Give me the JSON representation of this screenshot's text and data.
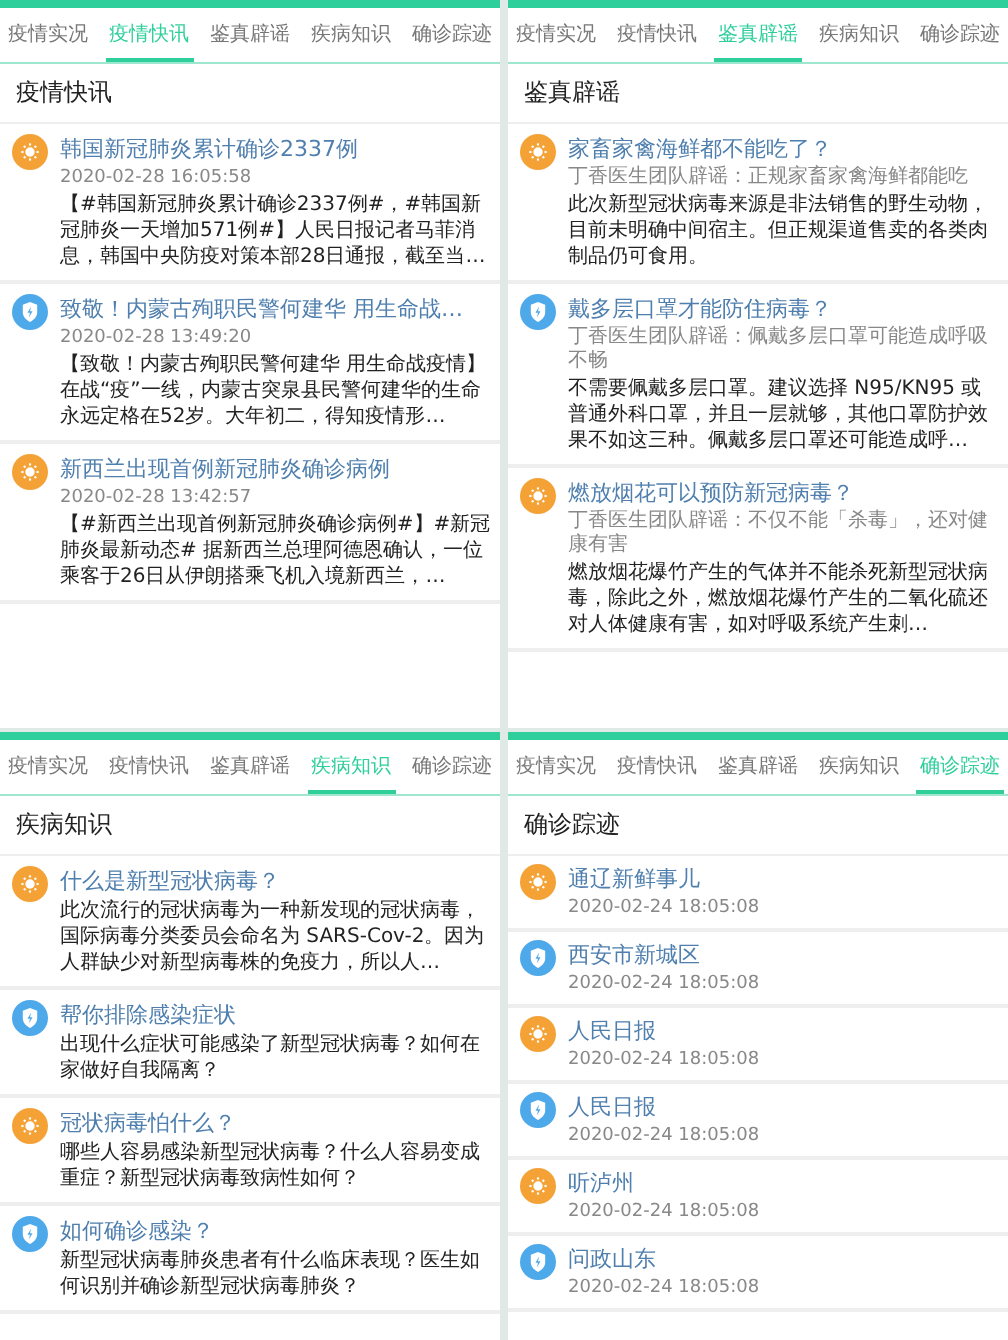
{
  "panels": [
    {
      "tabs": [
        {
          "label": "疫情实况",
          "selected": false
        },
        {
          "label": "疫情快讯",
          "selected": true
        },
        {
          "label": "鉴真辟谣",
          "selected": false
        },
        {
          "label": "疾病知识",
          "selected": false
        },
        {
          "label": "确诊踪迹",
          "selected": false
        }
      ],
      "heading": "疫情快讯",
      "items": [
        {
          "kind": "sun",
          "title": "韩国新冠肺炎累计确诊2337例",
          "meta": "2020-02-28 16:05:58",
          "body": "【#韩国新冠肺炎累计确诊2337例#，#韩国新冠肺炎一天增加571例#】人民日报记者马菲消息，韩国中央防疫对策本部28日通报，截至当…"
        },
        {
          "kind": "shield",
          "title": "致敬！内蒙古殉职民警何建华 用生命战…",
          "meta": "2020-02-28 13:49:20",
          "body": "【致敬！内蒙古殉职民警何建华 用生命战疫情】在战“疫”一线，内蒙古突泉县民警何建华的生命永远定格在52岁。大年初二，得知疫情形…"
        },
        {
          "kind": "sun",
          "title": "新西兰出现首例新冠肺炎确诊病例",
          "meta": "2020-02-28 13:42:57",
          "body": "【#新西兰出现首例新冠肺炎确诊病例#】#新冠肺炎最新动态# 据新西兰总理阿德恩确认，一位乘客于26日从伊朗搭乘飞机入境新西兰，…"
        }
      ]
    },
    {
      "tabs": [
        {
          "label": "疫情实况",
          "selected": false
        },
        {
          "label": "疫情快讯",
          "selected": false
        },
        {
          "label": "鉴真辟谣",
          "selected": true
        },
        {
          "label": "疾病知识",
          "selected": false
        },
        {
          "label": "确诊踪迹",
          "selected": false
        }
      ],
      "heading": "鉴真辟谣",
      "items": [
        {
          "kind": "sun",
          "title": "家畜家禽海鲜都不能吃了？",
          "meta": "丁香医生团队辟谣：正规家畜家禽海鲜都能吃",
          "body": "此次新型冠状病毒来源是非法销售的野生动物，目前未明确中间宿主。但正规渠道售卖的各类肉制品仍可食用。"
        },
        {
          "kind": "shield",
          "title": "戴多层口罩才能防住病毒？",
          "meta": "丁香医生团队辟谣：佩戴多层口罩可能造成呼吸不畅",
          "body": "不需要佩戴多层口罩。建议选择 N95/KN95 或普通外科口罩，并且一层就够，其他口罩防护效果不如这三种。佩戴多层口罩还可能造成呼…"
        },
        {
          "kind": "sun",
          "title": "燃放烟花可以预防新冠病毒？",
          "meta": "丁香医生团队辟谣：不仅不能「杀毒」，还对健康有害",
          "body": "燃放烟花爆竹产生的气体并不能杀死新型冠状病毒，除此之外，燃放烟花爆竹产生的二氧化硫还对人体健康有害，如对呼吸系统产生刺…"
        }
      ]
    },
    {
      "tabs": [
        {
          "label": "疫情实况",
          "selected": false
        },
        {
          "label": "疫情快讯",
          "selected": false
        },
        {
          "label": "鉴真辟谣",
          "selected": false
        },
        {
          "label": "疾病知识",
          "selected": true
        },
        {
          "label": "确诊踪迹",
          "selected": false
        }
      ],
      "heading": "疾病知识",
      "items": [
        {
          "kind": "sun",
          "title": "什么是新型冠状病毒？",
          "body": "此次流行的冠状病毒为一种新发现的冠状病毒，国际病毒分类委员会命名为 SARS-Cov-2。因为人群缺少对新型病毒株的免疫力，所以人…"
        },
        {
          "kind": "shield",
          "title": "帮你排除感染症状",
          "body": "出现什么症状可能感染了新型冠状病毒？如何在家做好自我隔离？"
        },
        {
          "kind": "sun",
          "title": "冠状病毒怕什么？",
          "body": "哪些人容易感染新型冠状病毒？什么人容易变成重症？新型冠状病毒致病性如何？"
        },
        {
          "kind": "shield",
          "title": "如何确诊感染？",
          "body": "新型冠状病毒肺炎患者有什么临床表现？医生如何识别并确诊新型冠状病毒肺炎？"
        }
      ]
    },
    {
      "tabs": [
        {
          "label": "疫情实况",
          "selected": false
        },
        {
          "label": "疫情快讯",
          "selected": false
        },
        {
          "label": "鉴真辟谣",
          "selected": false
        },
        {
          "label": "疾病知识",
          "selected": false
        },
        {
          "label": "确诊踪迹",
          "selected": true
        }
      ],
      "heading": "确诊踪迹",
      "items": [
        {
          "kind": "sun",
          "title": "通辽新鲜事儿",
          "meta": "2020-02-24 18:05:08"
        },
        {
          "kind": "shield",
          "title": "西安市新城区",
          "meta": "2020-02-24 18:05:08"
        },
        {
          "kind": "sun",
          "title": "人民日报",
          "meta": "2020-02-24 18:05:08"
        },
        {
          "kind": "shield",
          "title": "人民日报",
          "meta": "2020-02-24 18:05:08"
        },
        {
          "kind": "sun",
          "title": "听泸州",
          "meta": "2020-02-24 18:05:08"
        },
        {
          "kind": "shield",
          "title": "问政山东",
          "meta": "2020-02-24 18:05:08"
        }
      ]
    }
  ]
}
